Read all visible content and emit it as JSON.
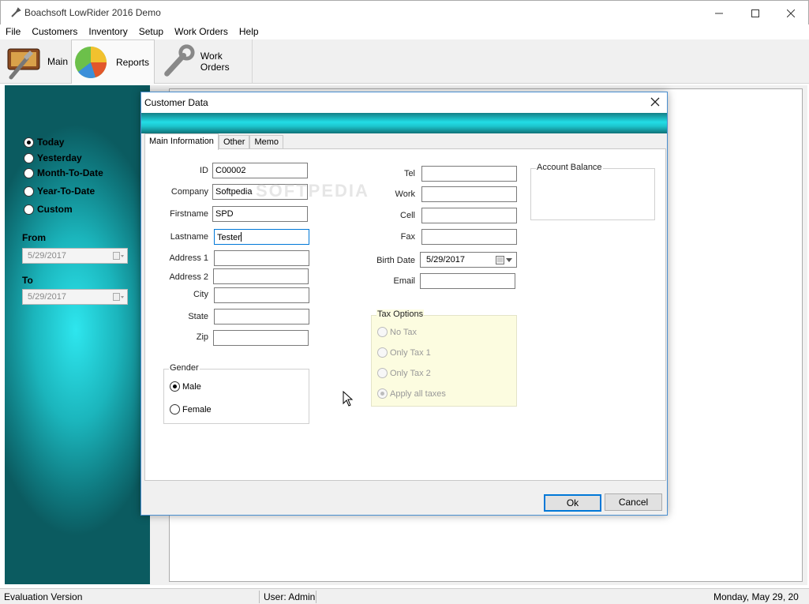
{
  "window": {
    "title": "Boachsoft LowRider 2016 Demo"
  },
  "menu": [
    "File",
    "Customers",
    "Inventory",
    "Setup",
    "Work Orders",
    "Help"
  ],
  "toolbar": {
    "main_label": "Main",
    "reports_label": "Reports",
    "workorders_label": "Work Orders"
  },
  "left_panel": {
    "ranges": [
      {
        "label": "Today",
        "checked": true
      },
      {
        "label": "Yesterday",
        "checked": false
      },
      {
        "label": "Month-To-Date",
        "checked": false
      },
      {
        "label": "Year-To-Date",
        "checked": false
      },
      {
        "label": "Custom",
        "checked": false
      }
    ],
    "from_label": "From",
    "from_value": "5/29/2017",
    "to_label": "To",
    "to_value": "5/29/2017"
  },
  "statusbar": {
    "left": "Evaluation Version",
    "user": "User: Admin",
    "date": "Monday, May 29, 20"
  },
  "dialog": {
    "title": "Customer Data",
    "tabs": [
      "Main Information",
      "Other",
      "Memo"
    ],
    "fields": {
      "id_label": "ID",
      "id_value": "C00002",
      "company_label": "Company",
      "company_value": "Softpedia",
      "firstname_label": "Firstname",
      "firstname_value": "SPD",
      "lastname_label": "Lastname",
      "lastname_value": "Tester",
      "address1_label": "Address 1",
      "address1_value": "",
      "address2_label": "Address 2",
      "address2_value": "",
      "city_label": "City",
      "city_value": "",
      "state_label": "State",
      "state_value": "",
      "zip_label": "Zip",
      "zip_value": "",
      "tel_label": "Tel",
      "tel_value": "",
      "work_label": "Work",
      "work_value": "",
      "cell_label": "Cell",
      "cell_value": "",
      "fax_label": "Fax",
      "fax_value": "",
      "birthdate_label": "Birth Date",
      "birthdate_value": "5/29/2017",
      "email_label": "Email",
      "email_value": ""
    },
    "gender": {
      "title": "Gender",
      "options": [
        {
          "label": "Male",
          "checked": true
        },
        {
          "label": "Female",
          "checked": false
        }
      ]
    },
    "tax": {
      "title": "Tax Options",
      "options": [
        {
          "label": "No Tax",
          "checked": false
        },
        {
          "label": "Only Tax 1",
          "checked": false
        },
        {
          "label": "Only Tax 2",
          "checked": false
        },
        {
          "label": "Apply all taxes",
          "checked": true
        }
      ]
    },
    "account_balance_title": "Account Balance",
    "watermark": "SOFTPEDIA",
    "ok_label": "Ok",
    "cancel_label": "Cancel"
  },
  "colors": {
    "accent_teal": "#1dc5cd",
    "focus_blue": "#0078d7",
    "tax_panel_bg": "#fcfce0"
  }
}
